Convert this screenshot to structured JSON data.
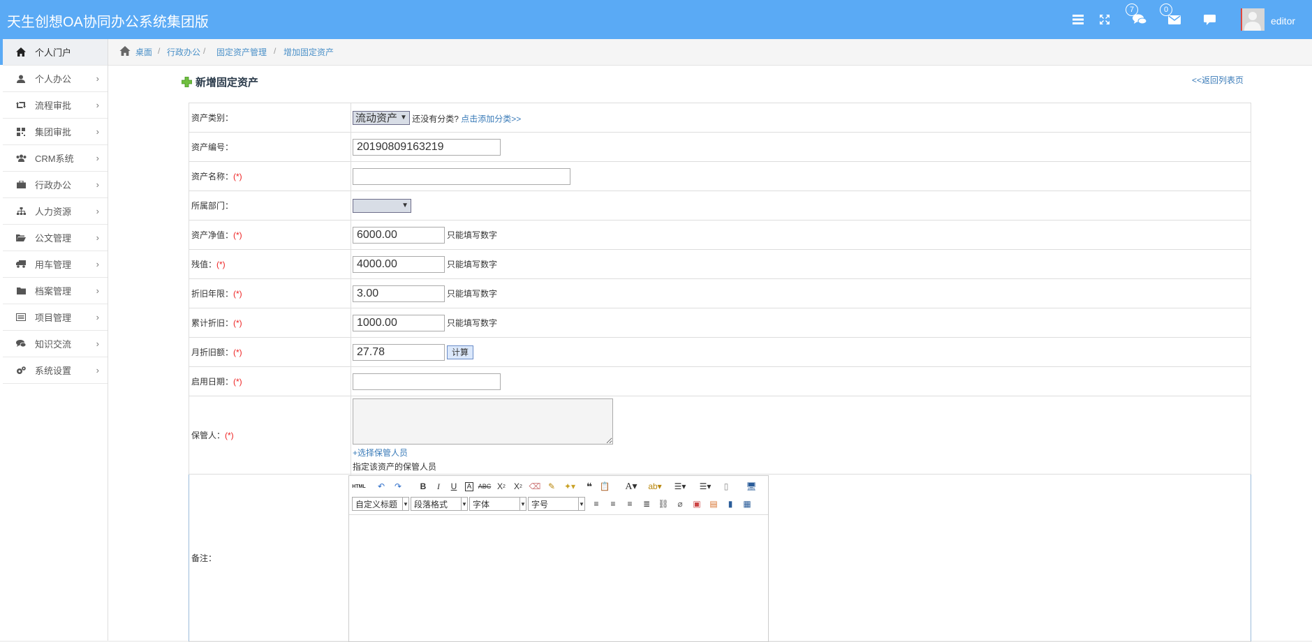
{
  "app": {
    "title": "天生创想OA协同办公系统集团版",
    "username": "editor",
    "msg_count": "7",
    "mail_count": "0"
  },
  "sidebar": {
    "items": [
      {
        "label": "个人门户",
        "icon": "home-icon"
      },
      {
        "label": "个人办公",
        "icon": "user-icon"
      },
      {
        "label": "流程审批",
        "icon": "retweet-icon"
      },
      {
        "label": "集团审批",
        "icon": "qrcode-icon"
      },
      {
        "label": "CRM系统",
        "icon": "group-icon"
      },
      {
        "label": "行政办公",
        "icon": "briefcase-icon"
      },
      {
        "label": "人力资源",
        "icon": "sitemap-icon"
      },
      {
        "label": "公文管理",
        "icon": "folder-open-icon"
      },
      {
        "label": "用车管理",
        "icon": "truck-icon"
      },
      {
        "label": "档案管理",
        "icon": "folder-icon"
      },
      {
        "label": "项目管理",
        "icon": "list-alt-icon"
      },
      {
        "label": "知识交流",
        "icon": "comments-icon"
      },
      {
        "label": "系统设置",
        "icon": "cogs-icon"
      }
    ]
  },
  "breadcrumb": [
    "桌面",
    "行政办公",
    "固定资产管理",
    "增加固定资产"
  ],
  "page": {
    "title": "新增固定资产",
    "back": "<<返回列表页"
  },
  "form": {
    "category_label": "资产类别：",
    "category_value": "流动资产",
    "category_hint": "还没有分类?",
    "category_link": "点击添加分类>>",
    "code_label": "资产编号：",
    "code_value": "20190809163219",
    "name_label": "资产名称：",
    "dept_label": "所属部门：",
    "net_label": "资产净值：",
    "net_value": "6000.00",
    "residual_label": "残值：",
    "residual_value": "4000.00",
    "years_label": "折旧年限：",
    "years_value": "3.00",
    "accum_label": "累计折旧：",
    "accum_value": "1000.00",
    "monthly_label": "月折旧额：",
    "monthly_value": "27.78",
    "calc_button": "计算",
    "start_label": "启用日期：",
    "keeper_label": "保管人：",
    "keeper_link": "+选择保管人员",
    "keeper_hint": "指定该资产的保管人员",
    "note_label": "备注：",
    "required": "(*)",
    "number_hint": "只能填写数字"
  },
  "editor": {
    "dropdowns": [
      "自定义标题",
      "段落格式",
      "字体",
      "字号"
    ]
  }
}
